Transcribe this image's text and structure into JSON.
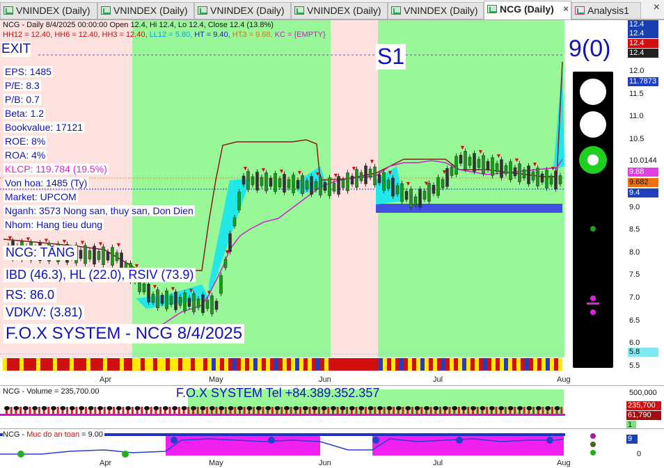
{
  "tabs": [
    {
      "label": "VNINDEX (Daily)",
      "active": false
    },
    {
      "label": "VNINDEX (Daily)",
      "active": false
    },
    {
      "label": "VNINDEX (Daily)",
      "active": false
    },
    {
      "label": "VNINDEX (Daily)",
      "active": false
    },
    {
      "label": "VNINDEX (Daily)",
      "active": false
    },
    {
      "label": "NCG (Daily)",
      "active": true
    },
    {
      "label": "Analysis1",
      "active": false
    }
  ],
  "tab_close": "×",
  "price_panel": {
    "header_line1": "NCG - Daily 8/4/2025 00:00:00 Open 12.4, Hi 12.4, Lo 12.4, Close 12.4 (13.8%)",
    "hh12": "HH12 = 12.40,",
    "hh6": "HH6 = 12.40,",
    "hh3": "HH3 = 12.40,",
    "ll12": "LL12 = 5.80,",
    "ht": "HT = 9.40,",
    "ht3": "HT3 = 9.68,",
    "kc": "KC = {EMPTY}",
    "exit_label": "EXIT",
    "s1_label": "S1",
    "count_label": "9(0)",
    "fundamentals": [
      "EPS: 1485",
      "P/E: 8.3",
      "P/B: 0.7",
      "Beta: 1.2",
      "Bookvalue: 17121",
      "ROE: 8%",
      "ROA: 4%",
      "KLCP: 119.784 (19.5%)",
      "Von hoa: 1485 (Ty)",
      "Market: UPCOM",
      "Nganh: 3573 Nong san, thuy san, Don Dien",
      "Nhom: Hang tieu dung"
    ],
    "status": "NCG: TĂNG",
    "ibd": "IBD (46.3), HL (22.0), RSIV (73.9)",
    "rs": "RS: 86.0",
    "vdk": "VDK/V:  (3.81)",
    "system_title": "F.O.X SYSTEM - NCG 8/4/2025",
    "y_ticks": [
      "12.0",
      "11.5",
      "11.0",
      "10.5",
      "10.0",
      "9.5",
      "9.0",
      "8.5",
      "8.0",
      "7.5",
      "7.0",
      "6.5",
      "6.0",
      "5.5"
    ],
    "tags": [
      {
        "text": "12.4",
        "color": "#1a3fb0"
      },
      {
        "text": "12.4",
        "color": "#1a3fb0"
      },
      {
        "text": "12.4",
        "color": "#d01010"
      },
      {
        "text": "12.4",
        "color": "#202020"
      },
      {
        "text": "11.7873",
        "color": "#2040c0"
      },
      {
        "text": "10.0144",
        "color": "#ffffff"
      },
      {
        "text": "9.88",
        "color": "#e040e0"
      },
      {
        "text": "9.682",
        "color": "#f07010"
      },
      {
        "text": "9.4",
        "color": "#2040c0"
      },
      {
        "text": "5.8",
        "color": "#80e8f0"
      }
    ],
    "months": [
      "Apr",
      "May",
      "Jun",
      "Jul",
      "Aug"
    ]
  },
  "volume_panel": {
    "header": "NCG - Volume = 235,700.00",
    "tel": "F.O.X SYSTEM Tel +84.389.352.357",
    "y_tick": "500,000",
    "tags": [
      {
        "text": "235,700",
        "color": "#d01010"
      },
      {
        "text": "61,790",
        "color": "#a01010"
      },
      {
        "text": "1",
        "color": "#80e080"
      }
    ]
  },
  "safety_panel": {
    "header_prefix": "NCG - ",
    "header_label": "Muc do an toan",
    "header_value": " = 9.00",
    "y_tick": "0",
    "tag": "9"
  }
}
